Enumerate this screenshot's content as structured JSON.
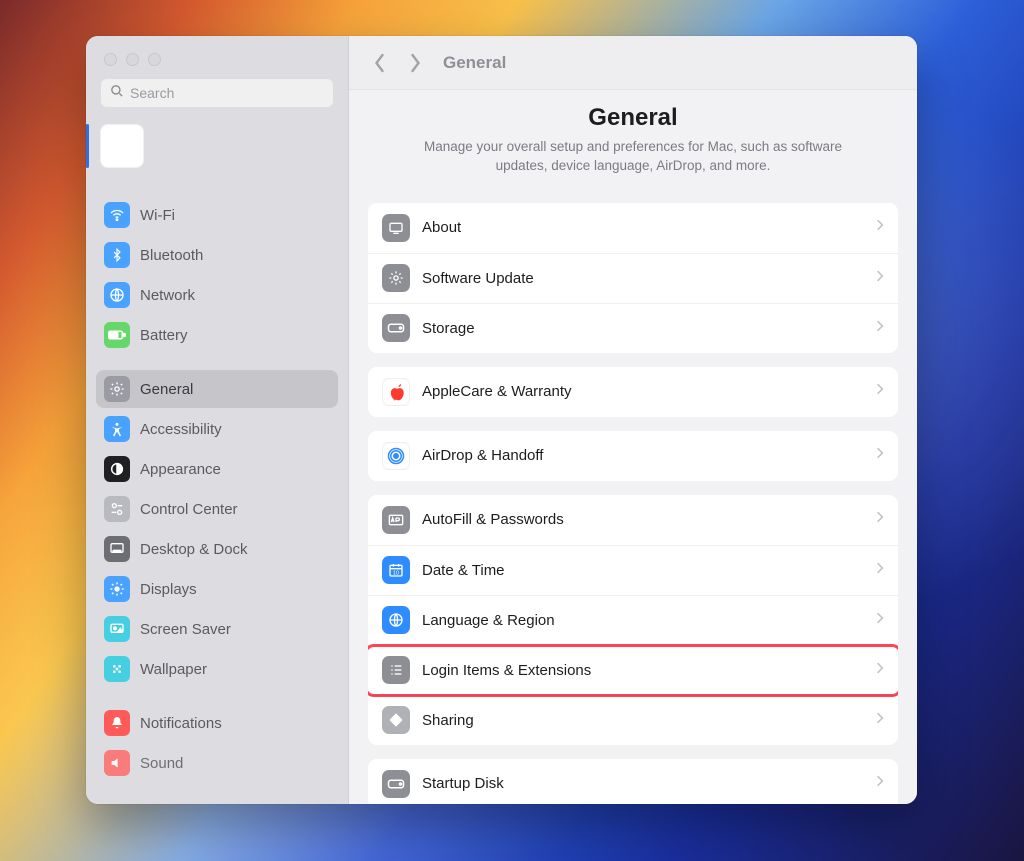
{
  "search": {
    "placeholder": "Search"
  },
  "toolbar": {
    "breadcrumb": "General"
  },
  "header": {
    "title": "General",
    "subtitle": "Manage your overall setup and preferences for Mac, such as software updates, device language, AirDrop, and more."
  },
  "sidebar": {
    "items": [
      {
        "label": "Wi-Fi"
      },
      {
        "label": "Bluetooth"
      },
      {
        "label": "Network"
      },
      {
        "label": "Battery"
      },
      {
        "label": "General"
      },
      {
        "label": "Accessibility"
      },
      {
        "label": "Appearance"
      },
      {
        "label": "Control Center"
      },
      {
        "label": "Desktop & Dock"
      },
      {
        "label": "Displays"
      },
      {
        "label": "Screen Saver"
      },
      {
        "label": "Wallpaper"
      },
      {
        "label": "Notifications"
      },
      {
        "label": "Sound"
      }
    ]
  },
  "content": {
    "groups": [
      {
        "rows": [
          {
            "label": "About"
          },
          {
            "label": "Software Update"
          },
          {
            "label": "Storage"
          }
        ]
      },
      {
        "rows": [
          {
            "label": "AppleCare & Warranty"
          }
        ]
      },
      {
        "rows": [
          {
            "label": "AirDrop & Handoff"
          }
        ]
      },
      {
        "rows": [
          {
            "label": "AutoFill & Passwords"
          },
          {
            "label": "Date & Time"
          },
          {
            "label": "Language & Region"
          },
          {
            "label": "Login Items & Extensions",
            "highlighted": true
          },
          {
            "label": "Sharing"
          }
        ]
      },
      {
        "rows": [
          {
            "label": "Startup Disk"
          }
        ]
      }
    ]
  }
}
